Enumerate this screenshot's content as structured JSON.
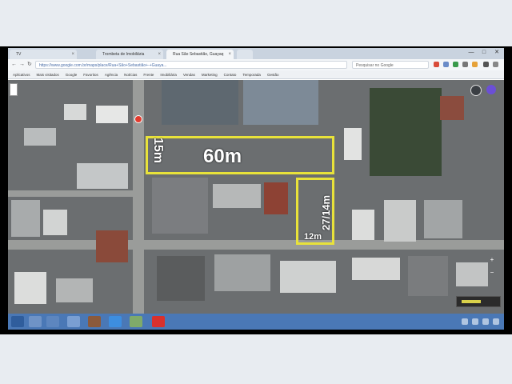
{
  "browser": {
    "tabs": [
      {
        "label": "TV",
        "active": false
      },
      {
        "label": "Trombeta de Imobiliária",
        "active": false
      },
      {
        "label": "Rua São Sebastião, Guayaq",
        "active": true
      },
      {
        "label": "",
        "active": false
      }
    ],
    "nav_back": "←",
    "nav_forward": "→",
    "nav_reload": "↻",
    "url": "https://www.google.com.br/maps/place/Rua+São+Sebastião+-+Guaya...",
    "search_box": "Pesquisar no Google",
    "window_controls": [
      "—",
      "□",
      "✕"
    ]
  },
  "bookmarks": [
    "Aplicativos",
    "Mais visitados",
    "Google",
    "Favoritos",
    "Agência",
    "Notícias",
    "Frente",
    "Imobiliária",
    "Vendas",
    "Marketing",
    "Contato",
    "Temporada",
    "Gestão"
  ],
  "map": {
    "measure_lot_width": "15m",
    "measure_lot_length": "60m",
    "measure_extension_depth": "27/14m",
    "measure_extension_width": "12m",
    "zoom_in": "+",
    "zoom_out": "−"
  }
}
